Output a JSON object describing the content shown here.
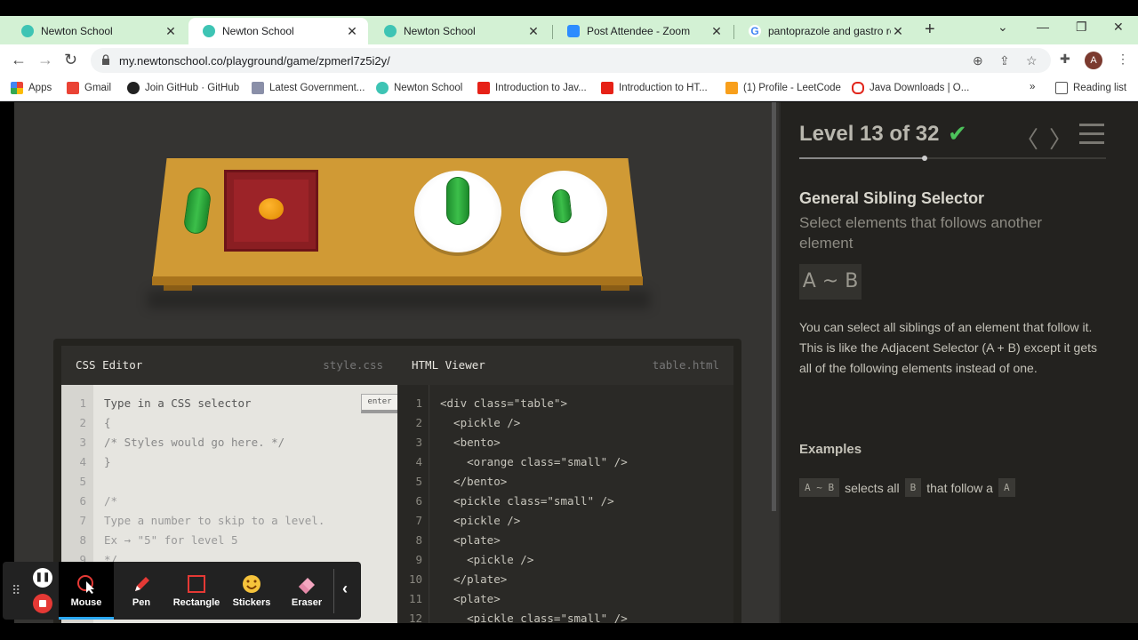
{
  "browser": {
    "tabs": [
      {
        "title": "Newton School",
        "favicon_color": "#3ec4b4"
      },
      {
        "title": "Newton School",
        "favicon_color": "#3ec4b4"
      },
      {
        "title": "Newton School",
        "favicon_color": "#3ec4b4"
      },
      {
        "title": "Post Attendee - Zoom",
        "favicon_color": "#2d8cff"
      },
      {
        "title": "pantoprazole and gastro resi",
        "favicon_color": "#ea4335"
      }
    ],
    "url": "my.newtonschool.co/playground/game/zpmerl7z5i2y/",
    "profile_initial": "A",
    "bookmarks": [
      "Apps",
      "Gmail",
      "Join GitHub · GitHub",
      "Latest Government...",
      "Newton School",
      "Introduction to Jav...",
      "Introduction to HT...",
      "(1) Profile - LeetCode",
      "Java Downloads | O..."
    ],
    "reading_list": "Reading list"
  },
  "editor": {
    "css_title": "CSS Editor",
    "css_file": "style.css",
    "html_title": "HTML Viewer",
    "html_file": "table.html",
    "enter_label": "enter",
    "css_lines": [
      {
        "n": "1",
        "text": "Type in a CSS selector"
      },
      {
        "n": "2",
        "text": "{"
      },
      {
        "n": "3",
        "text": "/* Styles would go here. */"
      },
      {
        "n": "4",
        "text": "}"
      },
      {
        "n": "5",
        "text": ""
      },
      {
        "n": "6",
        "text": "/*"
      },
      {
        "n": "7",
        "text": "Type a number to skip to a level."
      },
      {
        "n": "8",
        "text": "Ex → \"5\" for level 5"
      },
      {
        "n": "9",
        "text": "*/"
      }
    ],
    "html_lines": [
      {
        "n": "1",
        "text": "<div class=\"table\">"
      },
      {
        "n": "2",
        "text": "  <pickle />"
      },
      {
        "n": "3",
        "text": "  <bento>"
      },
      {
        "n": "4",
        "text": "    <orange class=\"small\" />"
      },
      {
        "n": "5",
        "text": "  </bento>"
      },
      {
        "n": "6",
        "text": "  <pickle class=\"small\" />"
      },
      {
        "n": "7",
        "text": "  <pickle />"
      },
      {
        "n": "8",
        "text": "  <plate>"
      },
      {
        "n": "9",
        "text": "    <pickle />"
      },
      {
        "n": "10",
        "text": "  </plate>"
      },
      {
        "n": "11",
        "text": "  <plate>"
      },
      {
        "n": "12",
        "text": "    <pickle class=\"small\" />"
      }
    ]
  },
  "level": {
    "label": "Level 13 of 32",
    "progress": 0.41,
    "title": "General Sibling Selector",
    "subtitle": "Select elements that follows another element",
    "syntax": "A ~ B",
    "description": "You can select all siblings of an element that follow it. This is like the Adjacent Selector (A + B) except it gets all of the following elements instead of one.",
    "examples_heading": "Examples",
    "example": {
      "code1": "A ~ B",
      "t1": "selects all",
      "code2": "B",
      "t2": "that follow a",
      "code3": "A"
    }
  },
  "recorder": {
    "tools": [
      "Mouse",
      "Pen",
      "Rectangle",
      "Stickers",
      "Eraser"
    ],
    "selected": "Mouse"
  },
  "colors": {
    "accent_green": "#4cc25b",
    "recorder_highlight": "#29a7f0"
  }
}
